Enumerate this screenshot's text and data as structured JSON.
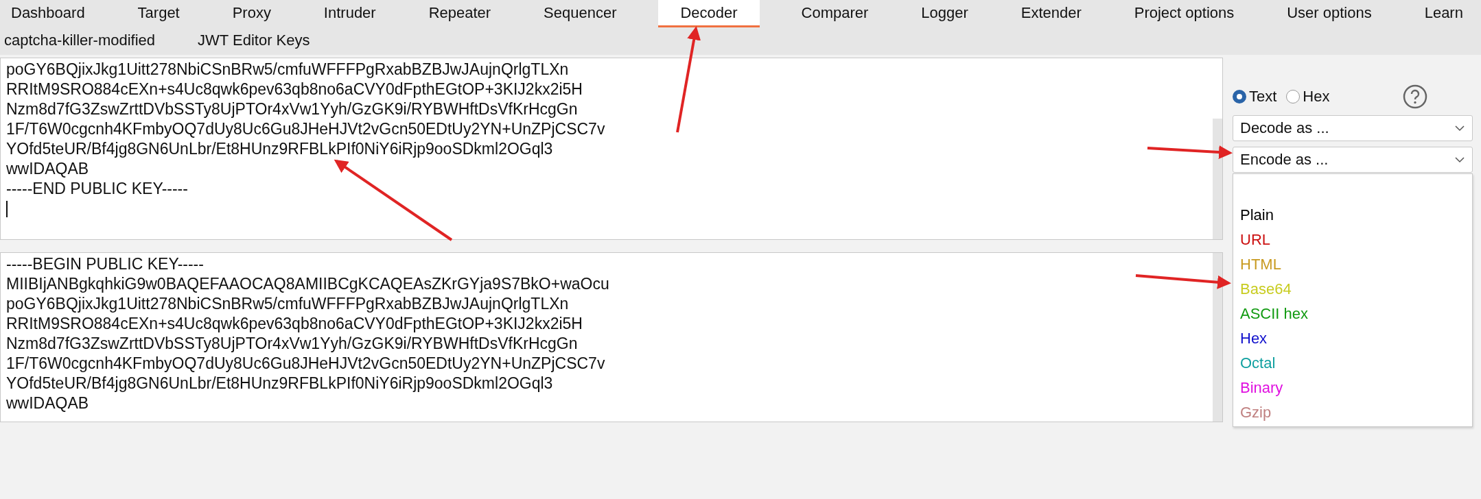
{
  "tabs": [
    {
      "label": "Dashboard",
      "selected": false
    },
    {
      "label": "Target",
      "selected": false
    },
    {
      "label": "Proxy",
      "selected": false
    },
    {
      "label": "Intruder",
      "selected": false
    },
    {
      "label": "Repeater",
      "selected": false
    },
    {
      "label": "Sequencer",
      "selected": false
    },
    {
      "label": "Decoder",
      "selected": true
    },
    {
      "label": "Comparer",
      "selected": false
    },
    {
      "label": "Logger",
      "selected": false
    },
    {
      "label": "Extender",
      "selected": false
    },
    {
      "label": "Project options",
      "selected": false
    },
    {
      "label": "User options",
      "selected": false
    },
    {
      "label": "Learn",
      "selected": false
    }
  ],
  "extension_tabs": [
    {
      "label": "captcha-killer-modified",
      "selected": false
    },
    {
      "label": "JWT Editor Keys",
      "selected": false
    }
  ],
  "input_editor": {
    "lines": [
      "poGY6BQjixJkg1Uitt278NbiCSnBRw5/cmfuWFFFPgRxabBZBJwJAujnQrlgTLXn",
      "RRItM9SRO884cEXn+s4Uc8qwk6pev63qb8no6aCVY0dFpthEGtOP+3KIJ2kx2i5H",
      "Nzm8d7fG3ZswZrttDVbSSTy8UjPTOr4xVw1Yyh/GzGK9i/RYBWHftDsVfKrHcgGn",
      "1F/T6W0cgcnh4KFmbyOQ7dUy8Uc6Gu8JHeHJVt2vGcn50EDtUy2YN+UnZPjCSC7v",
      "YOfd5teUR/Bf4jg8GN6UnLbr/Et8HUnz9RFBLkPIf0NiY6iRjp9ooSDkml2OGql3",
      "wwIDAQAB",
      "-----END PUBLIC KEY-----"
    ]
  },
  "output_editor": {
    "lines": [
      "-----BEGIN PUBLIC KEY-----",
      "MIIBIjANBgkqhkiG9w0BAQEFAAOCAQ8AMIIBCgKCAQEAsZKrGYja9S7BkO+waOcu",
      "poGY6BQjixJkg1Uitt278NbiCSnBRw5/cmfuWFFFPgRxabBZBJwJAujnQrlgTLXn",
      "RRItM9SRO884cEXn+s4Uc8qwk6pev63qb8no6aCVY0dFpthEGtOP+3KIJ2kx2i5H",
      "Nzm8d7fG3ZswZrttDVbSSTy8UjPTOr4xVw1Yyh/GzGK9i/RYBWHftDsVfKrHcgGn",
      "1F/T6W0cgcnh4KFmbyOQ7dUy8Uc6Gu8JHeHJVt2vGcn50EDtUy2YN+UnZPjCSC7v",
      "YOfd5teUR/Bf4jg8GN6UnLbr/Et8HUnz9RFBLkPIf0NiY6iRjp9ooSDkml2OGql3",
      "wwIDAQAB"
    ]
  },
  "mode": [
    {
      "label": "Text",
      "selected": true
    },
    {
      "label": "Hex",
      "selected": false
    }
  ],
  "decode_select": {
    "value": "Decode as ..."
  },
  "encode_select": {
    "value": "Encode as ...",
    "expanded": true
  },
  "encode_options": [
    {
      "label": "Plain",
      "color": "#000000"
    },
    {
      "label": "URL",
      "color": "#cc1010"
    },
    {
      "label": "HTML",
      "color": "#c89a20"
    },
    {
      "label": "Base64",
      "color": "#c8cc20"
    },
    {
      "label": "ASCII hex",
      "color": "#109a10"
    },
    {
      "label": "Hex",
      "color": "#1010cc"
    },
    {
      "label": "Octal",
      "color": "#10a0a0"
    },
    {
      "label": "Binary",
      "color": "#e010e0"
    },
    {
      "label": "Gzip",
      "color": "#c08080"
    }
  ]
}
